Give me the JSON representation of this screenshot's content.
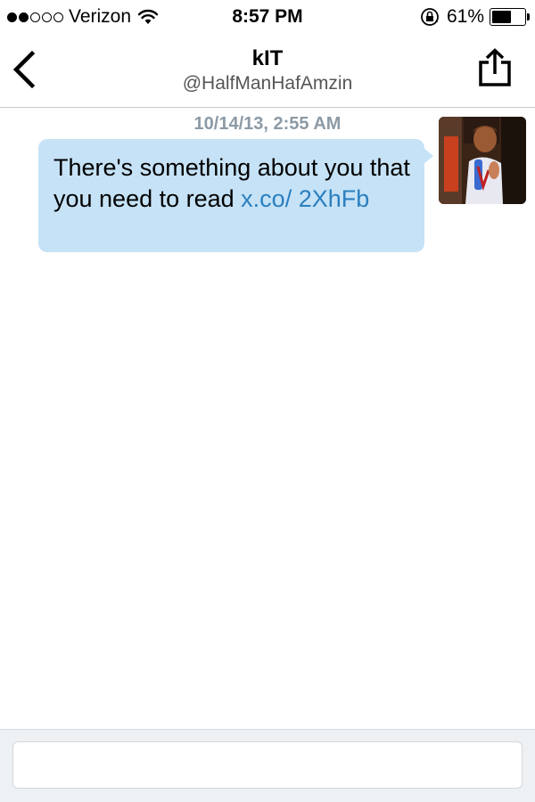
{
  "status_bar": {
    "carrier": "Verizon",
    "signal_bars_filled": 2,
    "signal_bars_total": 5,
    "time": "8:57 PM",
    "battery_percent": "61%",
    "icons": [
      "wifi-icon",
      "rotation-lock-icon",
      "battery-icon"
    ]
  },
  "nav": {
    "title": "kIT",
    "subtitle": "@HalfManHafAmzin",
    "back_icon": "chevron-left-icon",
    "share_icon": "share-icon"
  },
  "conversation": {
    "timestamp": "10/14/13, 2:55 AM",
    "message": {
      "text": "There's something about you that you need to read ",
      "link": "x.co/ 2XhFb",
      "bubble_color": "#c6e2f6",
      "link_color": "#2a7fbf"
    }
  },
  "composer": {
    "value": "",
    "placeholder": ""
  }
}
